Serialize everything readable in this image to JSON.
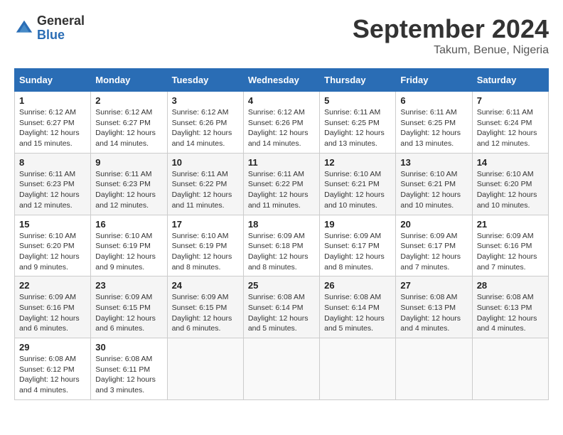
{
  "logo": {
    "general": "General",
    "blue": "Blue"
  },
  "title": "September 2024",
  "location": "Takum, Benue, Nigeria",
  "weekdays": [
    "Sunday",
    "Monday",
    "Tuesday",
    "Wednesday",
    "Thursday",
    "Friday",
    "Saturday"
  ],
  "weeks": [
    [
      {
        "day": "1",
        "sunrise": "6:12 AM",
        "sunset": "6:27 PM",
        "daylight": "12 hours and 15 minutes."
      },
      {
        "day": "2",
        "sunrise": "6:12 AM",
        "sunset": "6:27 PM",
        "daylight": "12 hours and 14 minutes."
      },
      {
        "day": "3",
        "sunrise": "6:12 AM",
        "sunset": "6:26 PM",
        "daylight": "12 hours and 14 minutes."
      },
      {
        "day": "4",
        "sunrise": "6:12 AM",
        "sunset": "6:26 PM",
        "daylight": "12 hours and 14 minutes."
      },
      {
        "day": "5",
        "sunrise": "6:11 AM",
        "sunset": "6:25 PM",
        "daylight": "12 hours and 13 minutes."
      },
      {
        "day": "6",
        "sunrise": "6:11 AM",
        "sunset": "6:25 PM",
        "daylight": "12 hours and 13 minutes."
      },
      {
        "day": "7",
        "sunrise": "6:11 AM",
        "sunset": "6:24 PM",
        "daylight": "12 hours and 12 minutes."
      }
    ],
    [
      {
        "day": "8",
        "sunrise": "6:11 AM",
        "sunset": "6:23 PM",
        "daylight": "12 hours and 12 minutes."
      },
      {
        "day": "9",
        "sunrise": "6:11 AM",
        "sunset": "6:23 PM",
        "daylight": "12 hours and 12 minutes."
      },
      {
        "day": "10",
        "sunrise": "6:11 AM",
        "sunset": "6:22 PM",
        "daylight": "12 hours and 11 minutes."
      },
      {
        "day": "11",
        "sunrise": "6:11 AM",
        "sunset": "6:22 PM",
        "daylight": "12 hours and 11 minutes."
      },
      {
        "day": "12",
        "sunrise": "6:10 AM",
        "sunset": "6:21 PM",
        "daylight": "12 hours and 10 minutes."
      },
      {
        "day": "13",
        "sunrise": "6:10 AM",
        "sunset": "6:21 PM",
        "daylight": "12 hours and 10 minutes."
      },
      {
        "day": "14",
        "sunrise": "6:10 AM",
        "sunset": "6:20 PM",
        "daylight": "12 hours and 10 minutes."
      }
    ],
    [
      {
        "day": "15",
        "sunrise": "6:10 AM",
        "sunset": "6:20 PM",
        "daylight": "12 hours and 9 minutes."
      },
      {
        "day": "16",
        "sunrise": "6:10 AM",
        "sunset": "6:19 PM",
        "daylight": "12 hours and 9 minutes."
      },
      {
        "day": "17",
        "sunrise": "6:10 AM",
        "sunset": "6:19 PM",
        "daylight": "12 hours and 8 minutes."
      },
      {
        "day": "18",
        "sunrise": "6:09 AM",
        "sunset": "6:18 PM",
        "daylight": "12 hours and 8 minutes."
      },
      {
        "day": "19",
        "sunrise": "6:09 AM",
        "sunset": "6:17 PM",
        "daylight": "12 hours and 8 minutes."
      },
      {
        "day": "20",
        "sunrise": "6:09 AM",
        "sunset": "6:17 PM",
        "daylight": "12 hours and 7 minutes."
      },
      {
        "day": "21",
        "sunrise": "6:09 AM",
        "sunset": "6:16 PM",
        "daylight": "12 hours and 7 minutes."
      }
    ],
    [
      {
        "day": "22",
        "sunrise": "6:09 AM",
        "sunset": "6:16 PM",
        "daylight": "12 hours and 6 minutes."
      },
      {
        "day": "23",
        "sunrise": "6:09 AM",
        "sunset": "6:15 PM",
        "daylight": "12 hours and 6 minutes."
      },
      {
        "day": "24",
        "sunrise": "6:09 AM",
        "sunset": "6:15 PM",
        "daylight": "12 hours and 6 minutes."
      },
      {
        "day": "25",
        "sunrise": "6:08 AM",
        "sunset": "6:14 PM",
        "daylight": "12 hours and 5 minutes."
      },
      {
        "day": "26",
        "sunrise": "6:08 AM",
        "sunset": "6:14 PM",
        "daylight": "12 hours and 5 minutes."
      },
      {
        "day": "27",
        "sunrise": "6:08 AM",
        "sunset": "6:13 PM",
        "daylight": "12 hours and 4 minutes."
      },
      {
        "day": "28",
        "sunrise": "6:08 AM",
        "sunset": "6:13 PM",
        "daylight": "12 hours and 4 minutes."
      }
    ],
    [
      {
        "day": "29",
        "sunrise": "6:08 AM",
        "sunset": "6:12 PM",
        "daylight": "12 hours and 4 minutes."
      },
      {
        "day": "30",
        "sunrise": "6:08 AM",
        "sunset": "6:11 PM",
        "daylight": "12 hours and 3 minutes."
      },
      null,
      null,
      null,
      null,
      null
    ]
  ]
}
